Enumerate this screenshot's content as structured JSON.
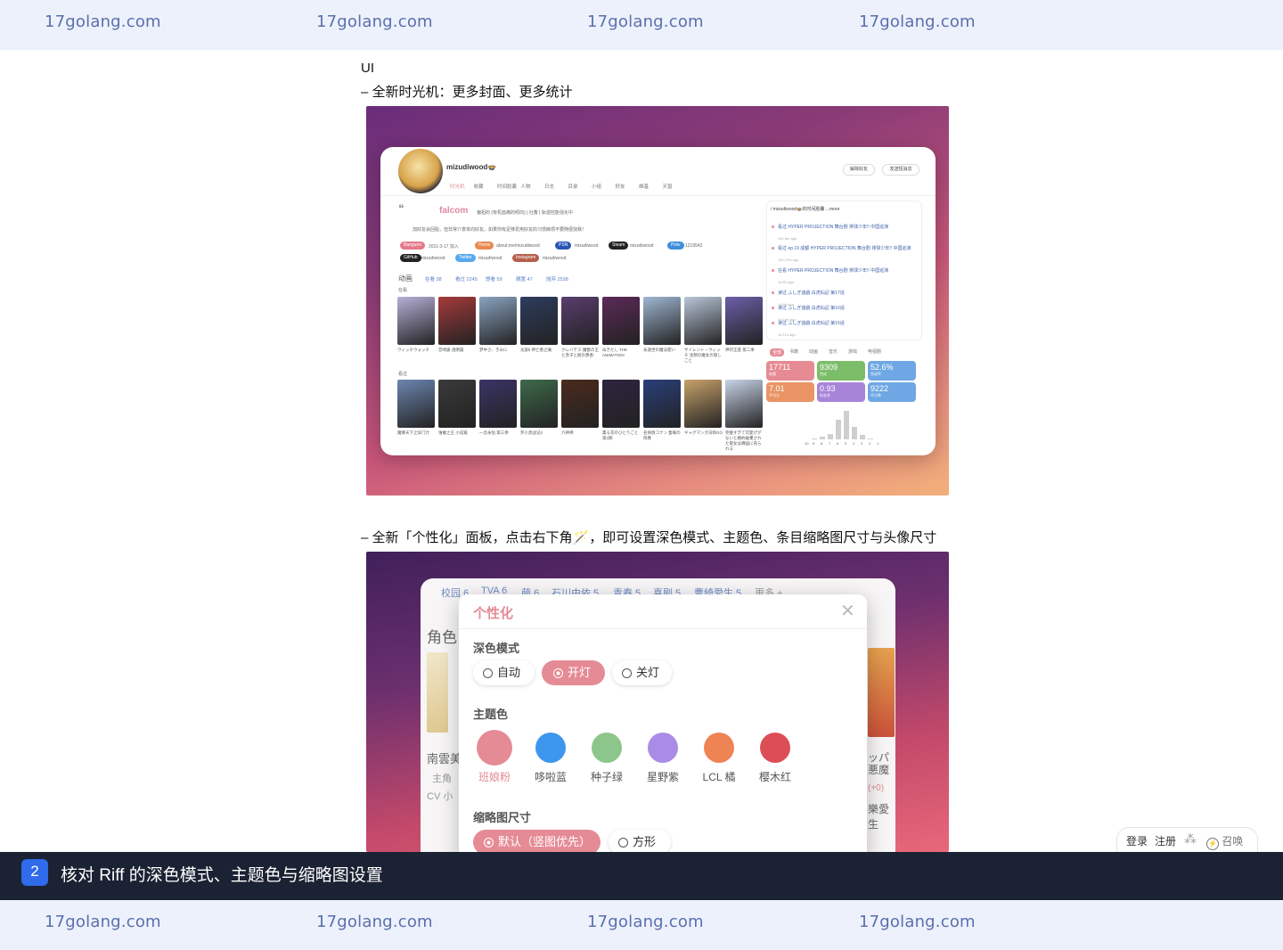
{
  "watermark": "17golang.com",
  "section_title": "UI",
  "bullet1": "– 全新时光机：更多封面、更多统计",
  "bullet2": "– 全新「个性化」面板，点击右下角🪄，即可设置深色模式、主题色、条目缩略图尺寸与头像尺寸",
  "screenshot1": {
    "username": "mizudiwood",
    "username_suffix": "🍲",
    "header_buttons": [
      "解除好友",
      "发送短消息"
    ],
    "nav": [
      "时光机",
      "收藏",
      "时间胶囊",
      "人物",
      "日志",
      "目录",
      "小组",
      "好友",
      "维基",
      "天窗"
    ],
    "quote_name": "falcom",
    "quote_text": "偏袒的 (有机盐痛的倾向) | 社畜 | 轨迹控能强化中",
    "bio": "加好友会回贴，但非常介意单向好友。如果你有足够爱用好友的习惯麻烦不要随便加我！",
    "tags": [
      {
        "label": "Bangumi",
        "value": "2011-3-17 加入",
        "color": "#e47a8a"
      },
      {
        "label": "Home",
        "value": "about:me/mizudiwood",
        "color": "#e9884f"
      },
      {
        "label": "PSN",
        "value": "mizudiwood",
        "color": "#2c55b8"
      },
      {
        "label": "Steam",
        "value": "mizudiwood",
        "color": "#222222"
      },
      {
        "label": "Pixiv",
        "value": "1219542",
        "color": "#3d8edb"
      },
      {
        "label": "GitHub",
        "value": "mizudiwood",
        "color": "#222222"
      },
      {
        "label": "Twitter",
        "value": "mizudiwood",
        "color": "#55a9ec"
      },
      {
        "label": "Instagram",
        "value": "mizudiwood",
        "color": "#b5604c"
      }
    ],
    "anime_heading": "动画",
    "anime_stats": [
      "在看 38",
      "看过 2245",
      "想看 59",
      "搁置 47",
      "抛弃 2538"
    ],
    "row1_label": "在看",
    "row2_label": "看过",
    "row1": [
      {
        "title": "ウィッチウォッチ",
        "color": "#b7b0d8"
      },
      {
        "title": "宫崎骏·透明篇",
        "color": "#a53a3a"
      },
      {
        "title": "梦中さ、きみに",
        "color": "#8aa3c0"
      },
      {
        "title": "龙族Ⅱ 神亡者之痛",
        "color": "#2d3d5e"
      },
      {
        "title": "クレバテス-魔獣の王と赤子と屍の勇者-",
        "color": "#5a3e6e"
      },
      {
        "title": "ぬきたし THE ANIMATION",
        "color": "#5c2a58"
      },
      {
        "title": "永遠世の魔法使い",
        "color": "#9fb6d2"
      },
      {
        "title": "サイレント・ウィッチ 沈黙の魔女の隠しごと",
        "color": "#b8c6d8"
      },
      {
        "title": "神印王座 第二季",
        "color": "#6b5fa8"
      }
    ],
    "row2": [
      {
        "title": "魔尊天下之穿门计",
        "color": "#6c86b0"
      },
      {
        "title": "谁敢之王 小说篇",
        "color": "#3a3a3a"
      },
      {
        "title": "一念永恒 第三季",
        "color": "#3a3466"
      },
      {
        "title": "罗小黑战记2",
        "color": "#3e6a4a"
      },
      {
        "title": "六神佛",
        "color": "#4b2a1e"
      },
      {
        "title": "薫る花のひとりごと 第2期",
        "color": "#2d2440"
      },
      {
        "title": "名探偵コナン 隻眼の残像",
        "color": "#2a3f7a"
      },
      {
        "title": "ギャグマンガ日和GO",
        "color": "#c7a26a"
      },
      {
        "title": "完璧すぎて可愛げがないと婚約破棄された聖女は隣国に売られる",
        "color": "#c9d4e8"
      }
    ],
    "timeline_title": "/ mizudiwood🍲的时间胶囊 ...more",
    "timeline": [
      {
        "text": "看过 HYPER PROJECTION 舞台剧 排球少年!! 中国巡演",
        "time": "10h 5m ago"
      },
      {
        "text": "看过 ep.19 成都 HYPER PROJECTION 舞台剧 排球少年!! 中国巡演",
        "time": "10h 27m ago"
      },
      {
        "text": "在看 HYPER PROJECTION 舞台剧 排球少年!! 中国巡演",
        "time": "1d 8h ago"
      },
      {
        "text": "读过 ふしぎ遊戯 白虎仙記 第17话",
        "time": "1d 9h ago"
      },
      {
        "text": "读过 ふしぎ遊戯 白虎仙記 第16话",
        "time": "1d 10h ago"
      },
      {
        "text": "读过 ふしぎ遊戯 白虎仙記 第15话",
        "time": "1d 11h ago"
      }
    ],
    "stat_tabs": [
      "全部",
      "书籍",
      "动画",
      "音乐",
      "游戏",
      "电视剧"
    ],
    "stats": [
      {
        "value": "17711",
        "label": "收藏",
        "color": "#e68a94"
      },
      {
        "value": "9309",
        "label": "完成",
        "color": "#7cbd6a"
      },
      {
        "value": "52.6%",
        "label": "完成率",
        "color": "#6ea7e4"
      },
      {
        "value": "7.01",
        "label": "平均分",
        "color": "#ea9465"
      },
      {
        "value": "0.93",
        "label": "标准差",
        "color": "#a884d9"
      },
      {
        "value": "9222",
        "label": "评分数",
        "color": "#6ea7e4"
      }
    ],
    "histogram": [
      1,
      2,
      6,
      14,
      48,
      70,
      30,
      10,
      3,
      1
    ],
    "histogram_labels": [
      "10",
      "9",
      "8",
      "7",
      "6",
      "5",
      "4",
      "3",
      "2",
      "1"
    ]
  },
  "screenshot2": {
    "bg_tags": [
      "校园 6",
      "TVA 6",
      "萌 6",
      "石川由依 5",
      "青春 5",
      "喜剧 5",
      "曹綺愛生 5",
      "更多 +"
    ],
    "left_peek": {
      "heading": "角色",
      "name": "南雲美",
      "role": "主角",
      "cv": "CV 小"
    },
    "right_peek": {
      "name": "ッパ",
      "sub": "悪魔",
      "extra": "(+0)",
      "cv": "樂愛生"
    },
    "panel_title": "个性化",
    "dark_mode_label": "深色模式",
    "dark_options": [
      "自动",
      "开灯",
      "关灯"
    ],
    "dark_selected": "开灯",
    "theme_label": "主题色",
    "themes": [
      {
        "name": "班娘粉",
        "color": "#e58b96"
      },
      {
        "name": "哆啦蓝",
        "color": "#3d97ee"
      },
      {
        "name": "种子绿",
        "color": "#8cc68a"
      },
      {
        "name": "星野紫",
        "color": "#a98ce6"
      },
      {
        "name": "LCL 橘",
        "color": "#ee8354"
      },
      {
        "name": "樱木红",
        "color": "#dc4e56"
      }
    ],
    "theme_selected": "班娘粉",
    "thumb_label": "缩略图尺寸",
    "thumb_options": [
      "默认（竖图优先）",
      "方形"
    ],
    "thumb_selected": "默认（竖图优先）"
  },
  "login_widget": {
    "login": "登录",
    "register": "注册",
    "summon": "召唤"
  },
  "caption": {
    "step": "2",
    "text": "核对 Riff 的深色模式、主题色与缩略图设置"
  }
}
